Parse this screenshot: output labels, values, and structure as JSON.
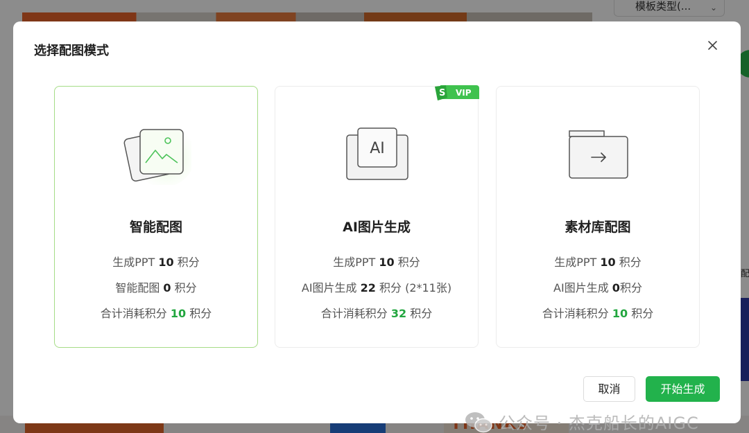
{
  "background": {
    "template_select_label": "模板类型(...",
    "side_text": "配",
    "thanks_text": "THANKS"
  },
  "modal": {
    "title": "选择配图模式",
    "cards": [
      {
        "title": "智能配图",
        "selected": true,
        "line1_prefix": "生成PPT ",
        "line1_value": "10",
        "line1_suffix": " 积分",
        "line2_prefix": "智能配图 ",
        "line2_value": "0",
        "line2_suffix": " 积分",
        "line3_prefix": "合计消耗积分 ",
        "line3_value": "10",
        "line3_suffix": " 积分"
      },
      {
        "title": "AI图片生成",
        "selected": false,
        "badge": "VIP",
        "icon_text": "AI",
        "line1_prefix": "生成PPT ",
        "line1_value": "10",
        "line1_suffix": " 积分",
        "line2_prefix": "AI图片生成 ",
        "line2_value": "22",
        "line2_suffix": " 积分 (2*11张)",
        "line3_prefix": "合计消耗积分 ",
        "line3_value": "32",
        "line3_suffix": " 积分"
      },
      {
        "title": "素材库配图",
        "selected": false,
        "line1_prefix": "生成PPT ",
        "line1_value": "10",
        "line1_suffix": " 积分",
        "line2_prefix": "AI图片生成 ",
        "line2_value": "0",
        "line2_suffix": "积分",
        "line3_prefix": "合计消耗积分 ",
        "line3_value": "10",
        "line3_suffix": " 积分"
      }
    ],
    "cancel_label": "取消",
    "start_label": "开始生成"
  },
  "watermark": "公众号 · 杰克船长的AIGC",
  "colors": {
    "accent_green": "#22b24c",
    "selected_border": "#a5dc86",
    "highlight_value": "#22a63f"
  }
}
